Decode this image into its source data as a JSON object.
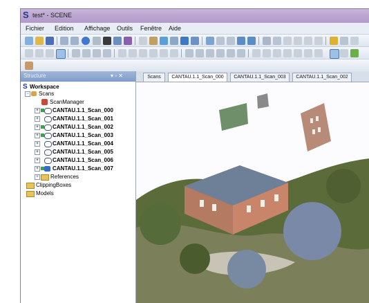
{
  "window": {
    "title": "test* - SCENE",
    "app_icon_glyph": "S"
  },
  "menu": [
    "Fichier",
    "Edition",
    "Affichage",
    "Outils",
    "Fenêtre",
    "Aide"
  ],
  "structure_panel": {
    "header": "Structure",
    "controls": "▾ ▫ ✕"
  },
  "tree": {
    "workspace": "Workspace",
    "scans": "Scans",
    "scan_manager": "ScanManager",
    "scan_items": [
      "CANTAU.1.1_Scan_000",
      "CANTAU.1.1_Scan_001",
      "CANTAU.1.1_Scan_002",
      "CANTAU.1.1_Scan_003",
      "CANTAU.1.1_Scan_004",
      "CANTAU.1.1_Scan_005",
      "CANTAU.1.1_Scan_006",
      "CANTAU.1.1_Scan_007"
    ],
    "references": "References",
    "clipping_boxes": "ClippingBoxes",
    "models": "Models"
  },
  "tabs": [
    "Scans",
    "CANTAU.1.1_Scan_000",
    "CANTAU.1.1_Scan_003",
    "CANTAU.1.1_Scan_002"
  ],
  "viewport": {
    "content": "3D point cloud view of building scan"
  },
  "colors": {
    "titlebar": "#b9a3cf",
    "panel_header": "#8aa6d0",
    "tree_green": "#2fa84a",
    "folder_yellow": "#e8c35a"
  }
}
